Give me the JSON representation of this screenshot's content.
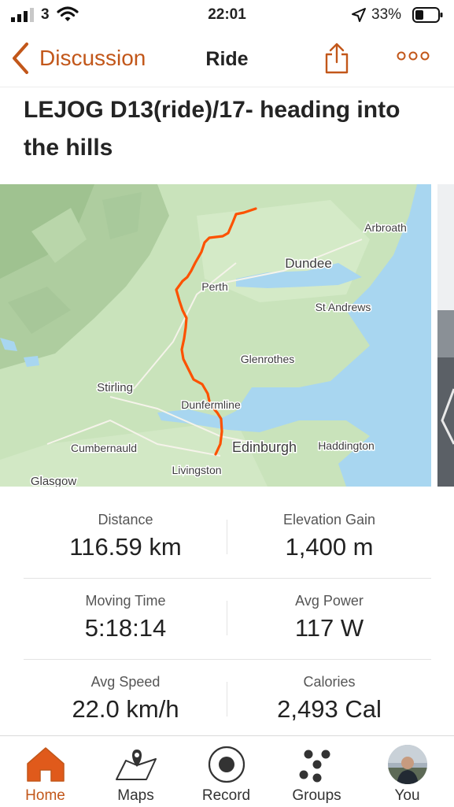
{
  "status_bar": {
    "carrier": "3",
    "time": "22:01",
    "battery": "33%"
  },
  "nav": {
    "back_label": "Discussion",
    "title": "Ride"
  },
  "activity": {
    "title": "LEJOG D13(ride)/17- heading into the hills"
  },
  "map": {
    "places": [
      {
        "name": "Arbroath"
      },
      {
        "name": "Dundee"
      },
      {
        "name": "Perth"
      },
      {
        "name": "St Andrews"
      },
      {
        "name": "Glenrothes"
      },
      {
        "name": "Stirling"
      },
      {
        "name": "Dunfermline"
      },
      {
        "name": "Cumbernauld"
      },
      {
        "name": "Edinburgh"
      },
      {
        "name": "Haddington"
      },
      {
        "name": "Livingston"
      },
      {
        "name": "Glasgow"
      }
    ],
    "route_color": "#fc5200"
  },
  "stats": [
    {
      "label": "Distance",
      "value": "116.59 km"
    },
    {
      "label": "Elevation Gain",
      "value": "1,400 m"
    },
    {
      "label": "Moving Time",
      "value": "5:18:14"
    },
    {
      "label": "Avg Power",
      "value": "117 W"
    },
    {
      "label": "Avg Speed",
      "value": "22.0 km/h"
    },
    {
      "label": "Calories",
      "value": "2,493 Cal"
    }
  ],
  "tabbar": {
    "items": [
      {
        "label": "Home",
        "icon": "home-icon",
        "active": true
      },
      {
        "label": "Maps",
        "icon": "map-icon",
        "active": false
      },
      {
        "label": "Record",
        "icon": "record-icon",
        "active": false
      },
      {
        "label": "Groups",
        "icon": "groups-icon",
        "active": false
      },
      {
        "label": "You",
        "icon": "avatar",
        "active": false
      }
    ]
  },
  "colors": {
    "accent": "#c2571a",
    "active_tab": "#e05a1b",
    "water": "#a9d7f0",
    "land": "#c8e3bb"
  }
}
